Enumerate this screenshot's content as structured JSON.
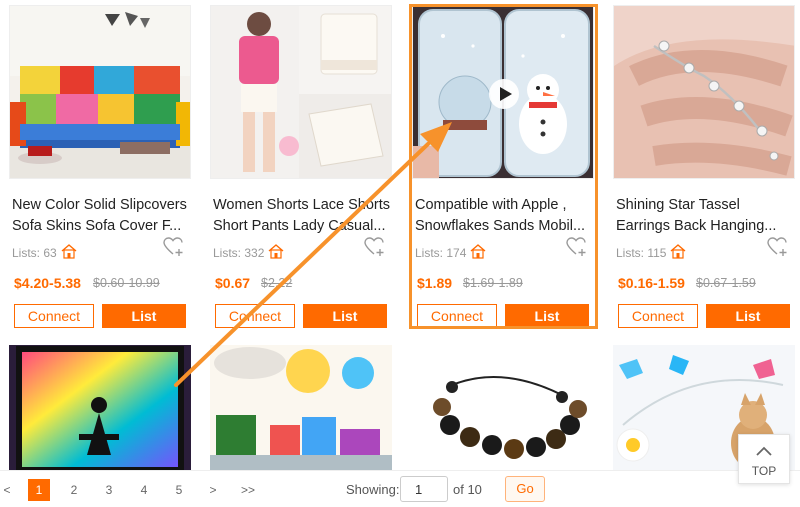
{
  "products": [
    {
      "title_line1": "New Color Solid Slipcovers",
      "title_line2": "Sofa Skins Sofa Cover F...",
      "lists": "Lists: 63",
      "price": "$4.20-5.38",
      "old_price": "$0.60-10.99",
      "connect_label": "Connect",
      "list_label": "List"
    },
    {
      "title_line1": "Women Shorts Lace Shorts",
      "title_line2": "Short Pants Lady Casual...",
      "lists": "Lists: 332",
      "price": "$0.67",
      "old_price": "$2.22",
      "connect_label": "Connect",
      "list_label": "List"
    },
    {
      "title_line1": "Compatible with Apple ,",
      "title_line2": "Snowflakes Sands Mobil...",
      "lists": "Lists: 174",
      "price": "$1.89",
      "old_price": "$1.69-1.89",
      "connect_label": "Connect",
      "list_label": "List"
    },
    {
      "title_line1": "Shining Star Tassel",
      "title_line2": "Earrings Back Hanging...",
      "lists": "Lists: 115",
      "price": "$0.16-1.59",
      "old_price": "$0.67-1.59",
      "connect_label": "Connect",
      "list_label": "List"
    }
  ],
  "icons": {
    "house": "house-icon",
    "heart": "heart-plus-icon",
    "play": "play-icon",
    "top": "chevron-up-icon"
  },
  "pagination": {
    "prev": "<",
    "pages": [
      "1",
      "2",
      "3",
      "4",
      "5"
    ],
    "active_page": "1",
    "next": ">",
    "last": ">>",
    "showing_label": "Showing:",
    "page_input_value": "1",
    "of_label": "of 10",
    "go_label": "Go"
  },
  "top_button": {
    "label": "TOP"
  },
  "colors": {
    "accent": "#ff6a00",
    "highlight_border": "#f7922b",
    "muted_text": "#999999"
  }
}
